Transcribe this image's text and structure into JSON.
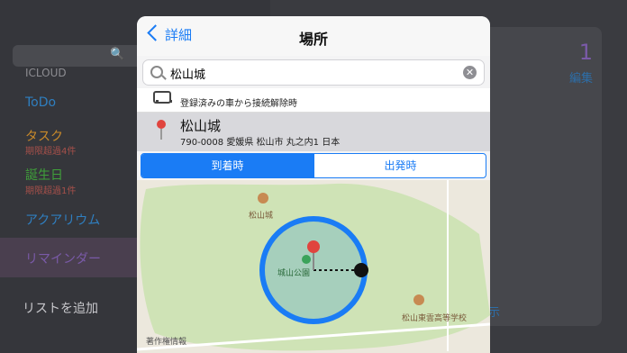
{
  "background": {
    "section": "ICLOUD",
    "lists": [
      {
        "label": "ToDo",
        "color": "#2f7fc0"
      },
      {
        "label": "タスク",
        "color": "#c98a2a",
        "sub": "期限超過4件"
      },
      {
        "label": "誕生日",
        "color": "#3fa03a",
        "sub": "期限超過1件"
      },
      {
        "label": "アクアリウム",
        "color": "#2f7fc0"
      },
      {
        "label": "リマインダー",
        "color": "#7a5aa8"
      }
    ],
    "add_list": "リストを追加",
    "right_count": "1",
    "right_edit": "編集",
    "right_show": "示"
  },
  "nav": {
    "back_label": "詳細",
    "title": "場所"
  },
  "search": {
    "value": "松山城"
  },
  "results": {
    "car_text": "登録済みの車から接続解除時",
    "place_name": "松山城",
    "place_address": "790-0008 愛媛県 松山市 丸之内1 日本"
  },
  "segment": {
    "arrive": "到着時",
    "depart": "出発時",
    "selected": "到着時"
  },
  "map": {
    "castle_label": "松山城",
    "park_label": "城山公園",
    "school_label": "松山東雲高等学校",
    "credit": "著作権情報"
  },
  "colors": {
    "accent": "#1a7cf5",
    "geofence": "#1a7cf5",
    "pin": "#e0443e"
  }
}
